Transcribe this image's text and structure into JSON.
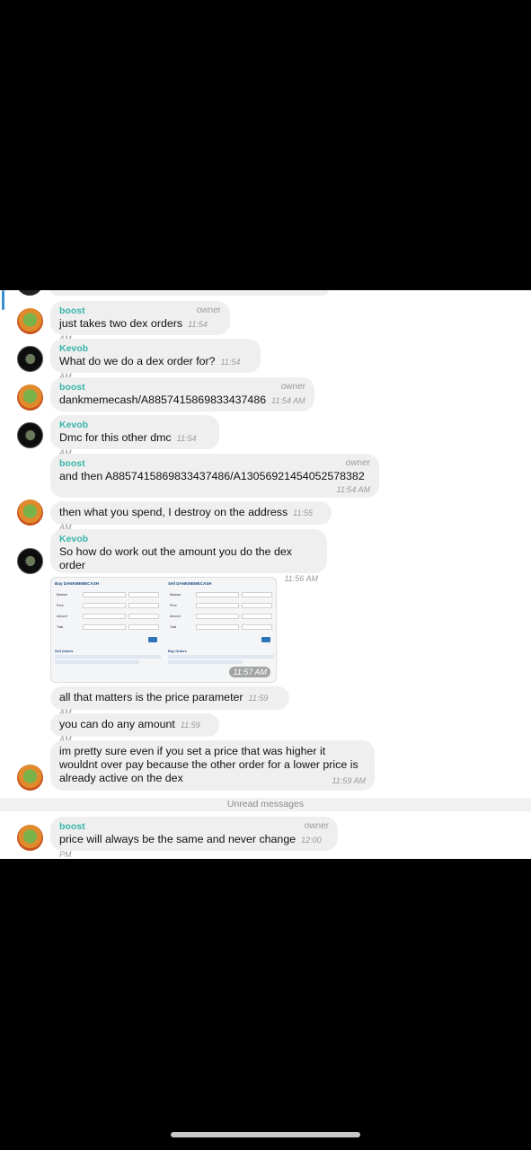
{
  "messages": [
    {
      "sender": "boost",
      "badge": "owner",
      "text": "just takes two dex orders",
      "time": "11:54 AM"
    },
    {
      "sender": "Kevob",
      "text": "What do we do a dex order for?",
      "time": "11:54 AM"
    },
    {
      "sender": "boost",
      "badge": "owner",
      "text": "dankmemecash/A8857415869833437486",
      "time": "11:54 AM"
    },
    {
      "sender": "Kevob",
      "text": "Dmc for this other dmc",
      "time": "11:54 AM"
    },
    {
      "sender": "boost",
      "badge": "owner",
      "text": "and then A8857415869833437486/A13056921454052578382",
      "time": "11:54 AM"
    },
    {
      "text": "then what you spend, I destroy on the address",
      "time": "11:55 AM"
    },
    {
      "sender": "Kevob",
      "text": "So how do work out the amount you do the dex order",
      "time": "11:56 AM"
    },
    {
      "text": "all that matters is the price parameter",
      "time": "11:59 AM"
    },
    {
      "text": "you can do any amount",
      "time": "11:59 AM"
    },
    {
      "text": "im pretty sure even if you set a price that was higher it wouldnt over pay because the other order for a lower price is already active on the dex",
      "time": "11:59 AM"
    },
    {
      "sender": "boost",
      "badge": "owner",
      "text": "price will always be the same and never change",
      "time": "12:00 PM"
    }
  ],
  "image_message": {
    "time": "11:57 AM",
    "buy_title": "Buy DANKMEMECASH",
    "sell_title": "Sell DANKMEMECASH",
    "fields": [
      "Balance",
      "Price",
      "Amount",
      "Total"
    ],
    "sell_orders_title": "Sell Orders",
    "buy_orders_title": "Buy Orders"
  },
  "unread_divider": "Unread messages",
  "colors": {
    "name": "#38b5a8",
    "bubble": "#efefef",
    "accent": "#3d8fd1"
  }
}
